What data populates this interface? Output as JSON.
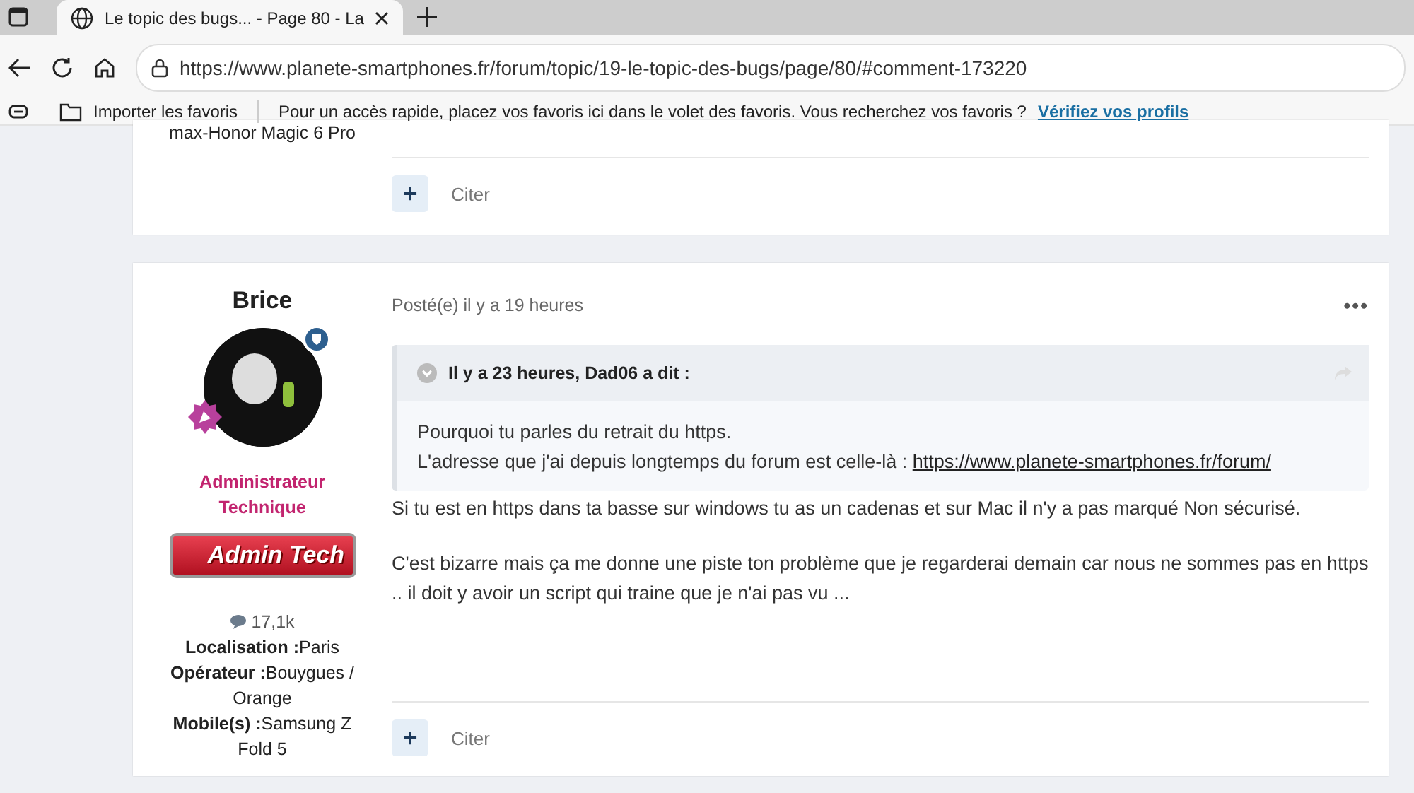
{
  "browser": {
    "tab": {
      "title": "Le topic des bugs... - Page 80 - La",
      "selected": true
    },
    "url": "https://www.planete-smartphones.fr/forum/topic/19-le-topic-des-bugs/page/80/#comment-173220",
    "favorites_bar": {
      "import": "Importer les favoris",
      "message": "Pour un accès rapide, placez vos favoris ici dans le volet des favoris. Vous recherchez vos favoris ?",
      "link": "Vérifiez vos profils"
    }
  },
  "posts": [
    {
      "kind": "partial",
      "author_info": [
        "max-Honor Magic 6 Pro"
      ],
      "add_button": "+",
      "quote_button": "Citer"
    },
    {
      "kind": "full",
      "author": "Brice",
      "role": "Administrateur Technique",
      "badge": "Admin Tech",
      "posts_count": "17,1k",
      "fields": [
        {
          "label": "Localisation :",
          "value": "Paris"
        },
        {
          "label": "Opérateur :",
          "value": "Bouygues / Orange"
        },
        {
          "label": "Mobile(s) :",
          "value": "Samsung Z Fold 5"
        }
      ],
      "posted": "Posté(e) il y a 19 heures",
      "menu": "•••",
      "quote": {
        "header": "Il y a 23 heures, Dad06 a dit :",
        "expanded": true,
        "lines": [
          "Pourquoi tu parles du retrait du https."
        ],
        "line_with_link": {
          "text": "L'adresse que j'ai depuis longtemps du forum est celle-là : ",
          "link": "https://www.planete-smartphones.fr/forum/"
        }
      },
      "paragraphs": [
        "Si tu est en https dans ta basse sur windows tu as un cadenas et sur Mac il n'y a pas marqué Non sécurisé.",
        "C'est bizarre mais ça me donne une piste ton problème que je regarderai demain car nous ne sommes pas en https .. il doit y avoir un script qui traine que je n'ai pas vu ..."
      ],
      "add_button": "+",
      "quote_button": "Citer"
    }
  ]
}
